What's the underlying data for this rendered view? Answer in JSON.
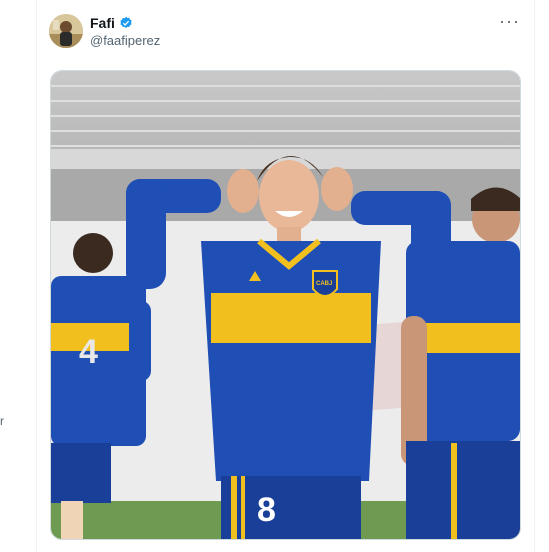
{
  "tweet": {
    "display_name": "Fafi",
    "handle": "@faafiperez",
    "verified": true,
    "more_icon": "more-horizontal-icon",
    "media": {
      "players": [
        {
          "number": "4"
        },
        {
          "number": "8"
        }
      ],
      "crest_text": "CABJ"
    }
  },
  "page": {
    "stray_text": "r"
  },
  "colors": {
    "verified_blue": "#1d9bf0",
    "boca_blue": "#1f4fb4",
    "boca_gold": "#f2c01e",
    "text_primary": "#0f1419",
    "text_secondary": "#536471"
  }
}
